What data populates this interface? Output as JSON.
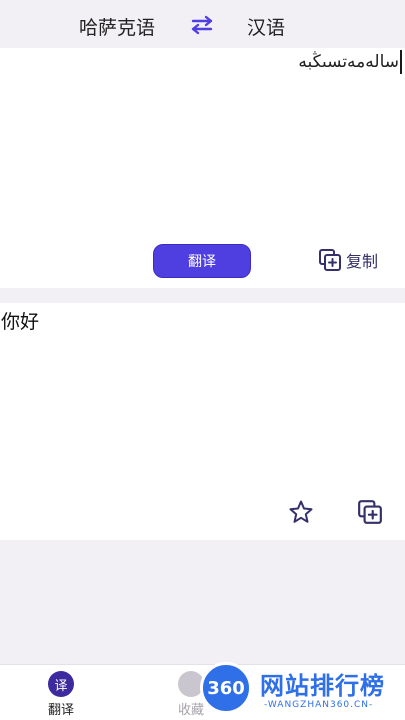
{
  "header": {
    "source_lang": "哈萨克语",
    "target_lang": "汉语",
    "swap_icon": "swap-arrows-icon"
  },
  "input": {
    "text": "سالەمەتسىڭبە",
    "translate_label": "翻译",
    "copy_label": "复制"
  },
  "output": {
    "text": "你好",
    "favorite_icon": "star-icon",
    "copy_icon": "copy-icon"
  },
  "tabbar": {
    "tabs": [
      {
        "label": "翻译",
        "glyph": "译"
      },
      {
        "label": "收藏",
        "glyph": ""
      }
    ]
  },
  "watermark": {
    "badge": "360",
    "title": "网站排行榜",
    "url": "-WANGZHAN360.CN-"
  },
  "colors": {
    "accent": "#4f3fe0",
    "tab_active": "#3d2a9e",
    "background": "#f2f0f4"
  }
}
